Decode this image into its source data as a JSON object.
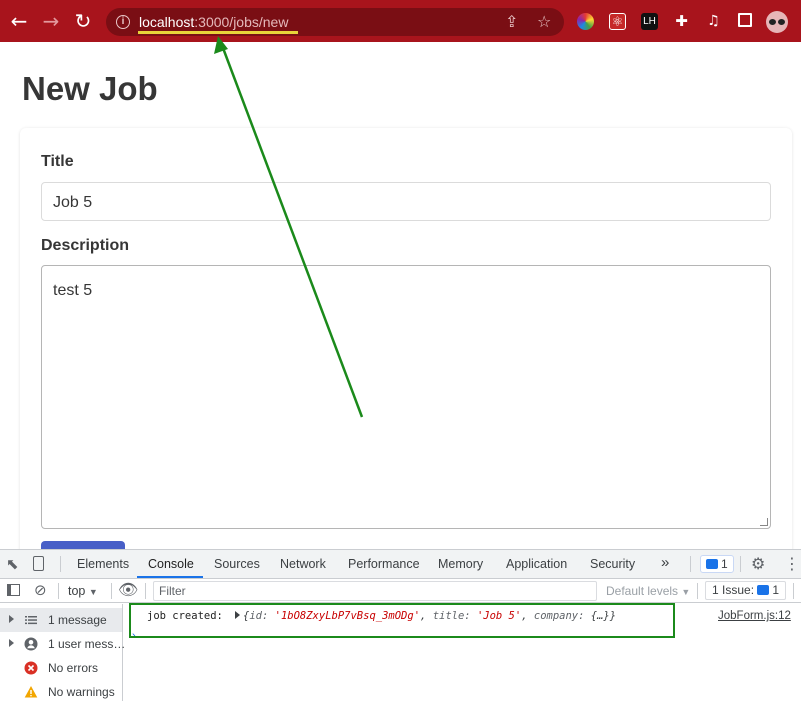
{
  "browser": {
    "url_host": "localhost",
    "url_path": ":3000/jobs/new"
  },
  "page": {
    "title": "New Job",
    "form": {
      "title_label": "Title",
      "title_value": "Job 5",
      "description_label": "Description",
      "description_value": "test 5"
    }
  },
  "devtools": {
    "tabs": [
      "Elements",
      "Console",
      "Sources",
      "Network",
      "Performance",
      "Memory",
      "Application",
      "Security"
    ],
    "active_tab": "Console",
    "overflow": "»",
    "issues_badge": "1",
    "context": "top",
    "filter_placeholder": "Filter",
    "levels": "Default levels",
    "issues": "1 Issue:",
    "issues_count": "1",
    "sidebar": [
      {
        "label": "1 message",
        "icon": "list-icon"
      },
      {
        "label": "1 user mess…",
        "icon": "user-icon"
      },
      {
        "label": "No errors",
        "icon": "error-icon"
      },
      {
        "label": "No warnings",
        "icon": "warning-icon"
      }
    ],
    "log": {
      "message": "job created:",
      "obj_open": "{",
      "k_id": "id: ",
      "v_id": "'1bO8ZxyLbP7vBsq_3mODg'",
      "sep1": ", ",
      "k_title": "title: ",
      "v_title": "'Job 5'",
      "sep2": ", ",
      "k_company": "company: ",
      "v_company": "{…}",
      "obj_close": "}",
      "source": "JobForm.js:12"
    }
  },
  "colors": {
    "chrome": "#a8141c",
    "annotation": "#1b8a1b",
    "url_underline": "#e9d23a"
  }
}
